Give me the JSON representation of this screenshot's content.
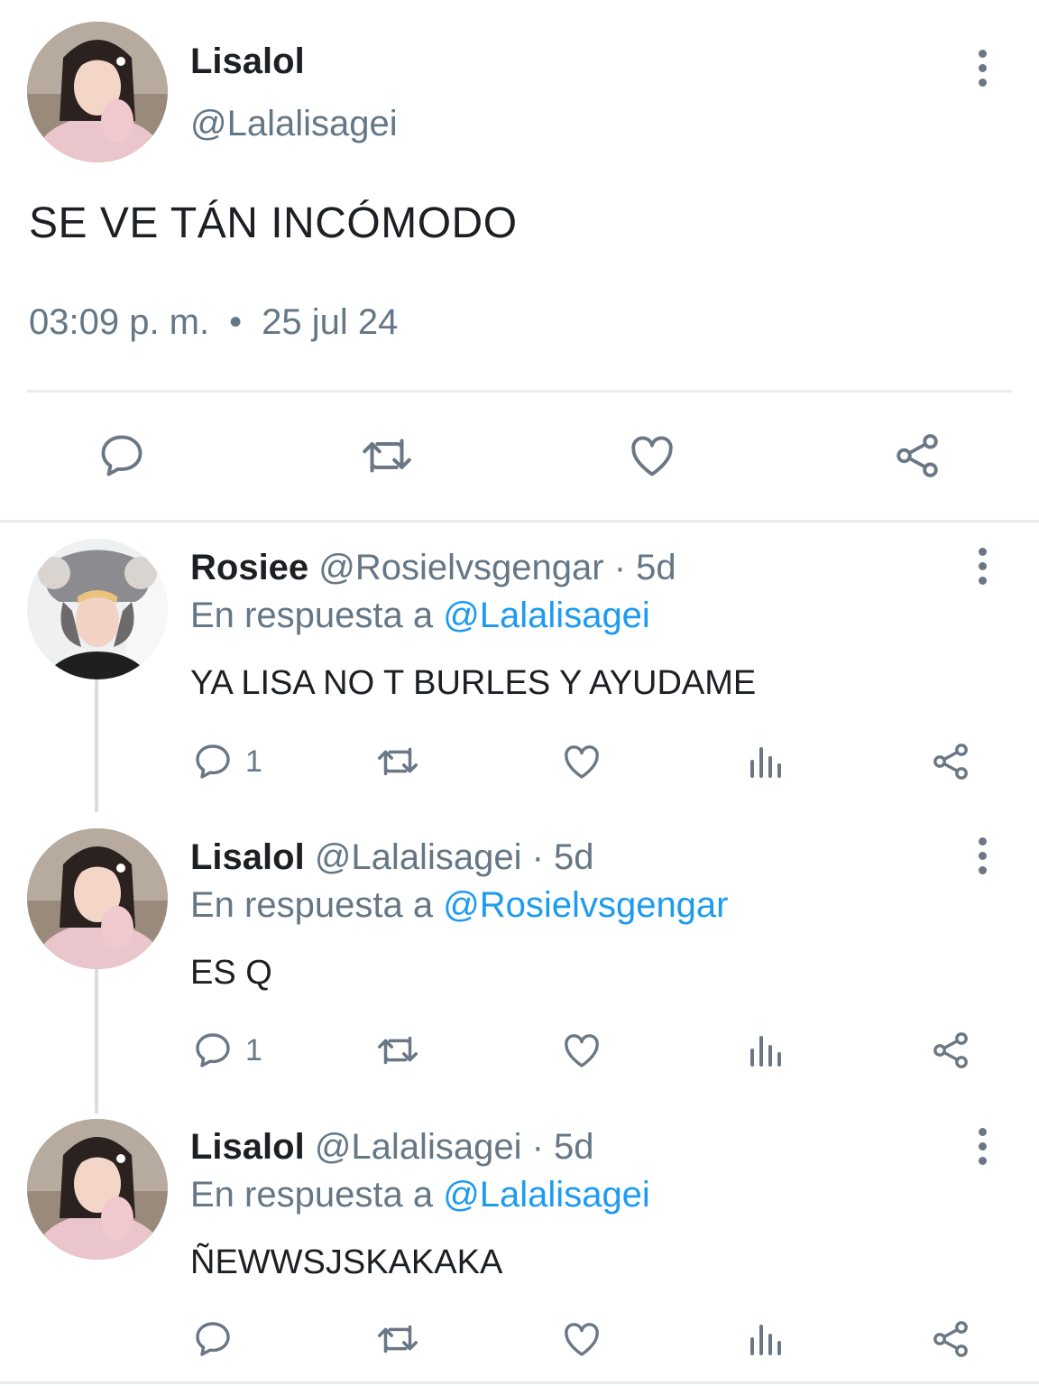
{
  "main_tweet": {
    "name": "Lisalol",
    "handle": "@Lalalisagei",
    "text": "SE VE TÁN INCÓMODO",
    "time": "03:09 p. m.",
    "date": "25 jul 24",
    "separator": "•"
  },
  "replies": [
    {
      "name": "Rosiee",
      "handle": "@Rosielvsgengar",
      "age": "· 5d",
      "in_reply_prefix": "En respuesta a",
      "in_reply_to": "@Lalalisagei",
      "text": "YA LISA NO T BURLES Y AYUDAME",
      "reply_count": "1"
    },
    {
      "name": "Lisalol",
      "handle": "@Lalalisagei",
      "age": "· 5d",
      "in_reply_prefix": "En respuesta a",
      "in_reply_to": "@Rosielvsgengar",
      "text": "ES Q",
      "reply_count": "1"
    },
    {
      "name": "Lisalol",
      "handle": "@Lalalisagei",
      "age": "· 5d",
      "in_reply_prefix": "En respuesta a",
      "in_reply_to": "@Lalalisagei",
      "text": "ÑEWWSJSKAKAKA",
      "reply_count": ""
    }
  ],
  "colors": {
    "link": "#1d9bf0",
    "secondary_text": "#657786",
    "icon": "#6b7784",
    "divider": "#e6ecf0"
  },
  "icons": [
    "reply-icon",
    "retweet-icon",
    "like-icon",
    "share-icon",
    "analytics-icon",
    "more-options-icon"
  ]
}
